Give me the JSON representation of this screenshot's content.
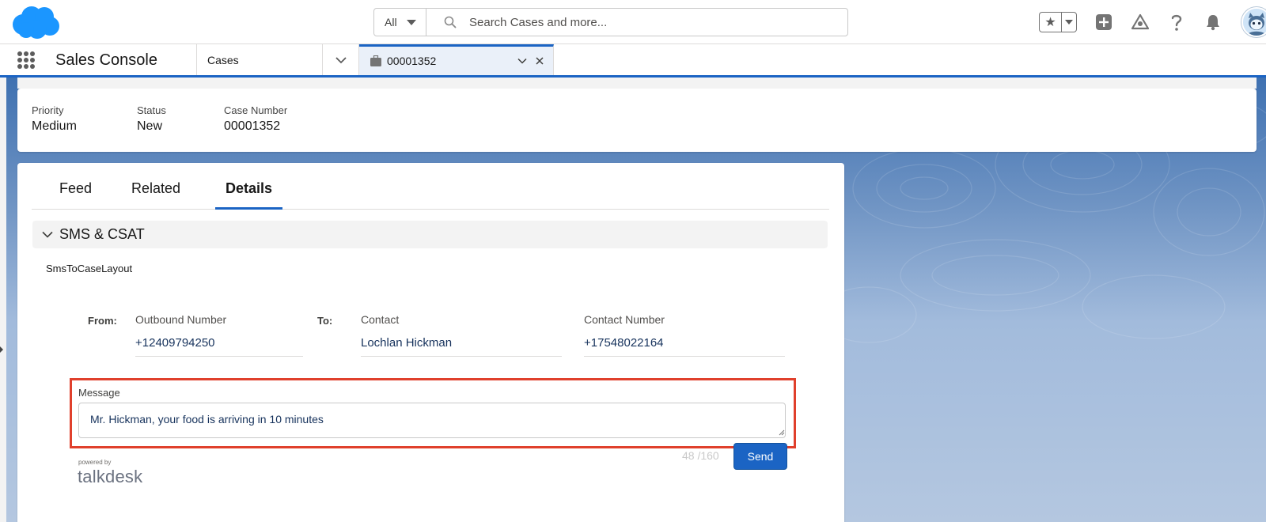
{
  "header": {
    "search_scope": "All",
    "search_placeholder": "Search Cases and more..."
  },
  "nav": {
    "app_name": "Sales Console",
    "object_tab": "Cases",
    "record_tab": "00001352"
  },
  "highlights": {
    "fields": [
      {
        "label": "Priority",
        "value": "Medium"
      },
      {
        "label": "Status",
        "value": "New"
      },
      {
        "label": "Case Number",
        "value": "00001352"
      }
    ]
  },
  "record": {
    "tabs": [
      {
        "label": "Feed",
        "active": false
      },
      {
        "label": "Related",
        "active": false
      },
      {
        "label": "Details",
        "active": true
      }
    ],
    "section_title": "SMS & CSAT",
    "layout_name": "SmsToCaseLayout"
  },
  "sms": {
    "from_label": "From:",
    "to_label": "To:",
    "outbound_label": "Outbound Number",
    "outbound_value": "+12409794250",
    "contact_label": "Contact",
    "contact_value": "Lochlan Hickman",
    "contact_number_label": "Contact Number",
    "contact_number_value": "+17548022164",
    "message_label": "Message",
    "message_value": "Mr. Hickman, your food is arriving in 10 minutes",
    "char_count": "48 /160",
    "send_label": "Send",
    "powered_by": "powered by",
    "brand": "talkdesk"
  },
  "colors": {
    "brand_blue": "#1b64c4",
    "highlight_red": "#e0402c"
  }
}
